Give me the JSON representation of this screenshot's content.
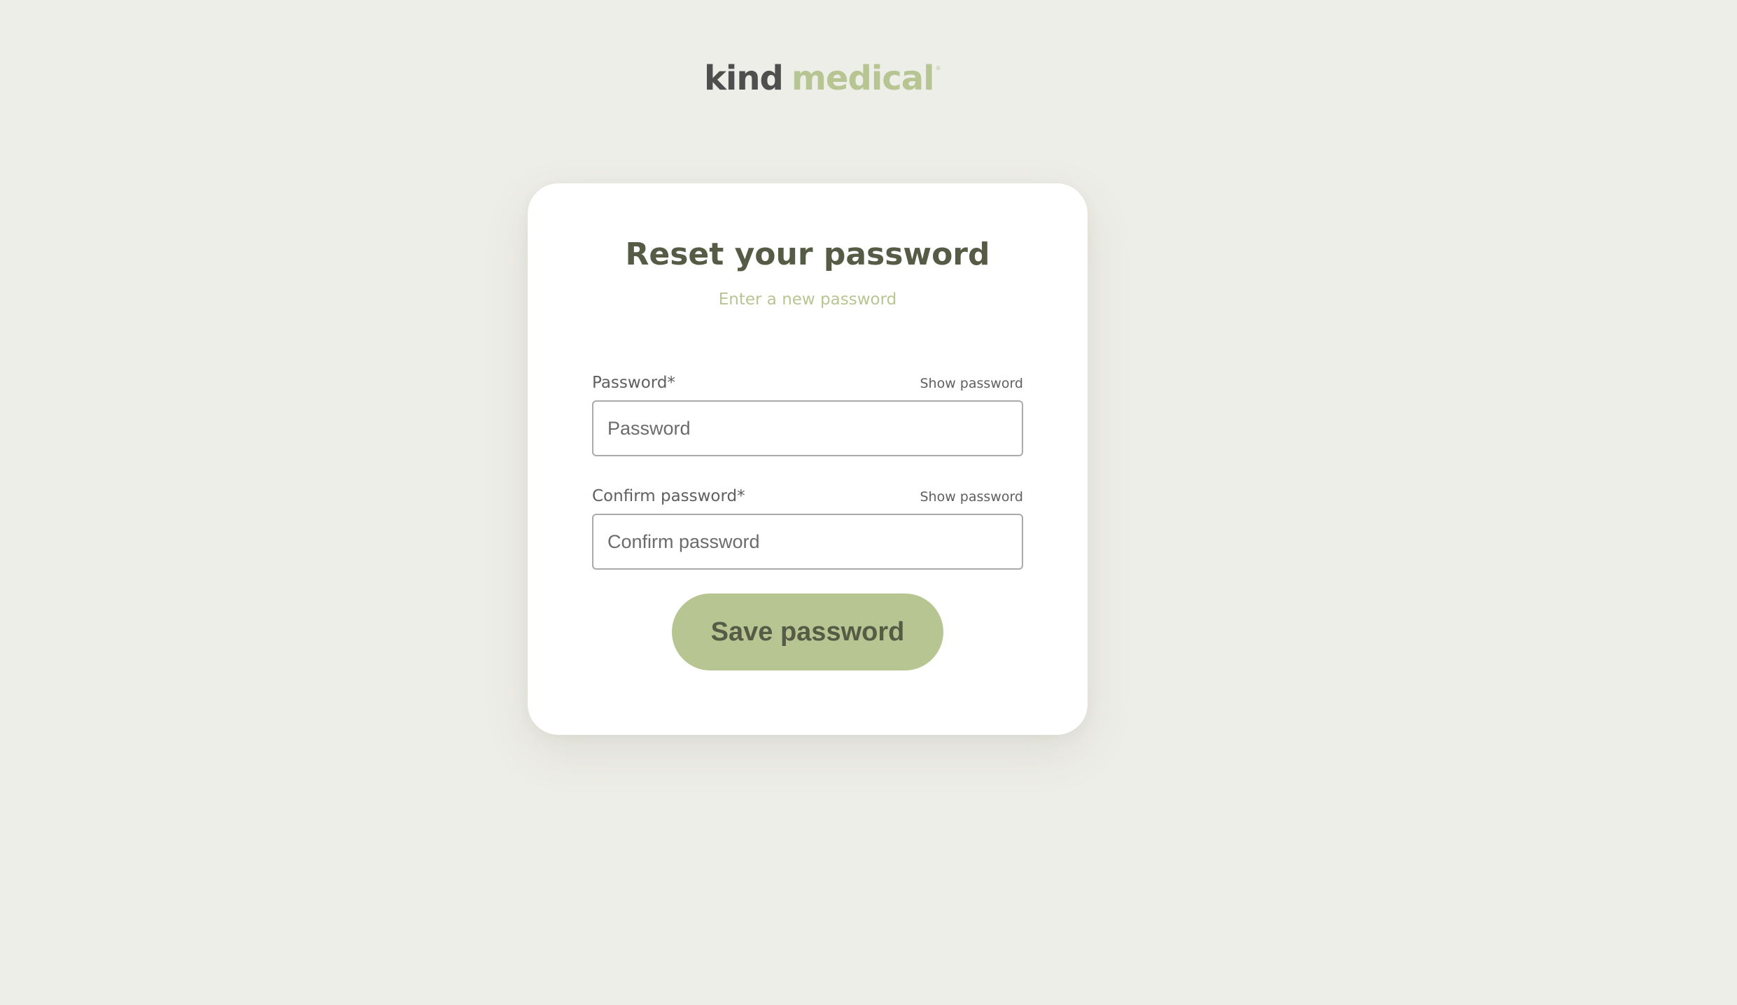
{
  "brand": {
    "logo_part1": "kind",
    "logo_part2": "medical",
    "logo_mark": "®"
  },
  "reset_form": {
    "title": "Reset your password",
    "subtitle": "Enter a new password",
    "password": {
      "label": "Password*",
      "show_label": "Show password",
      "placeholder": "Password",
      "value": ""
    },
    "confirm_password": {
      "label": "Confirm password*",
      "show_label": "Show password",
      "placeholder": "Confirm password",
      "value": ""
    },
    "save_label": "Save password"
  },
  "colors": {
    "background": "#eeeee8",
    "brand_green": "#b7c592",
    "heading_olive": "#565b45",
    "logo_gray": "#4f4f4f"
  }
}
